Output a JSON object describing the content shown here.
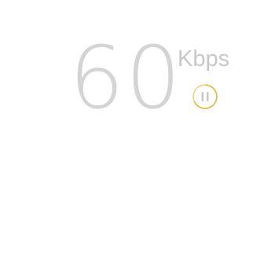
{
  "speed": {
    "value": "60",
    "unit": "Kbps"
  },
  "controls": {
    "pause_icon": "pause-icon",
    "ring_color": "#e0b63a",
    "bars_color": "#c8c8c8"
  }
}
